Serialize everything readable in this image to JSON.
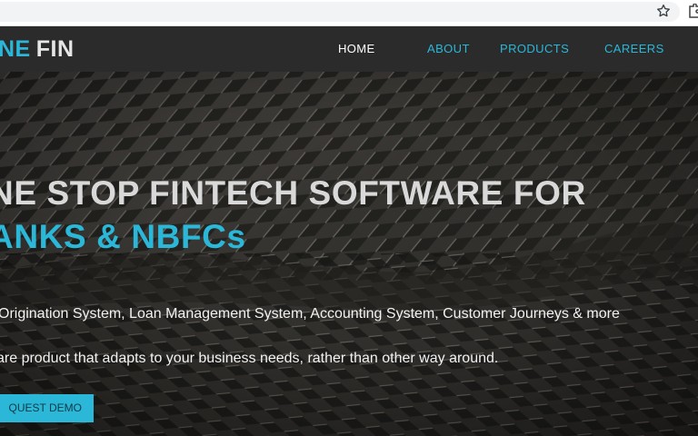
{
  "browser": {
    "bookmark_icon": "star-icon",
    "extensions_icon": "puzzle-icon"
  },
  "brand": {
    "logo_part_a": "NE",
    "logo_part_b": "FIN"
  },
  "nav": {
    "items": [
      {
        "label": "HOME"
      },
      {
        "label": "ABOUT"
      },
      {
        "label": "PRODUCTS"
      },
      {
        "label": "CAREERS"
      }
    ]
  },
  "hero": {
    "title_line1": "NE STOP FINTECH SOFTWARE FOR",
    "title_line2": "ANKS & NBFCs",
    "subtitle_line1": "Origination System, Loan Management System, Accounting System, Customer Journeys & more",
    "subtitle_line2": "are product that adapts to your business needs, rather than other way around.",
    "cta_label": "QUEST DEMO"
  },
  "colors": {
    "accent": "#2bb7d8",
    "nav_bg": "#2b2b2b",
    "hero_text": "#d9d9d9"
  }
}
